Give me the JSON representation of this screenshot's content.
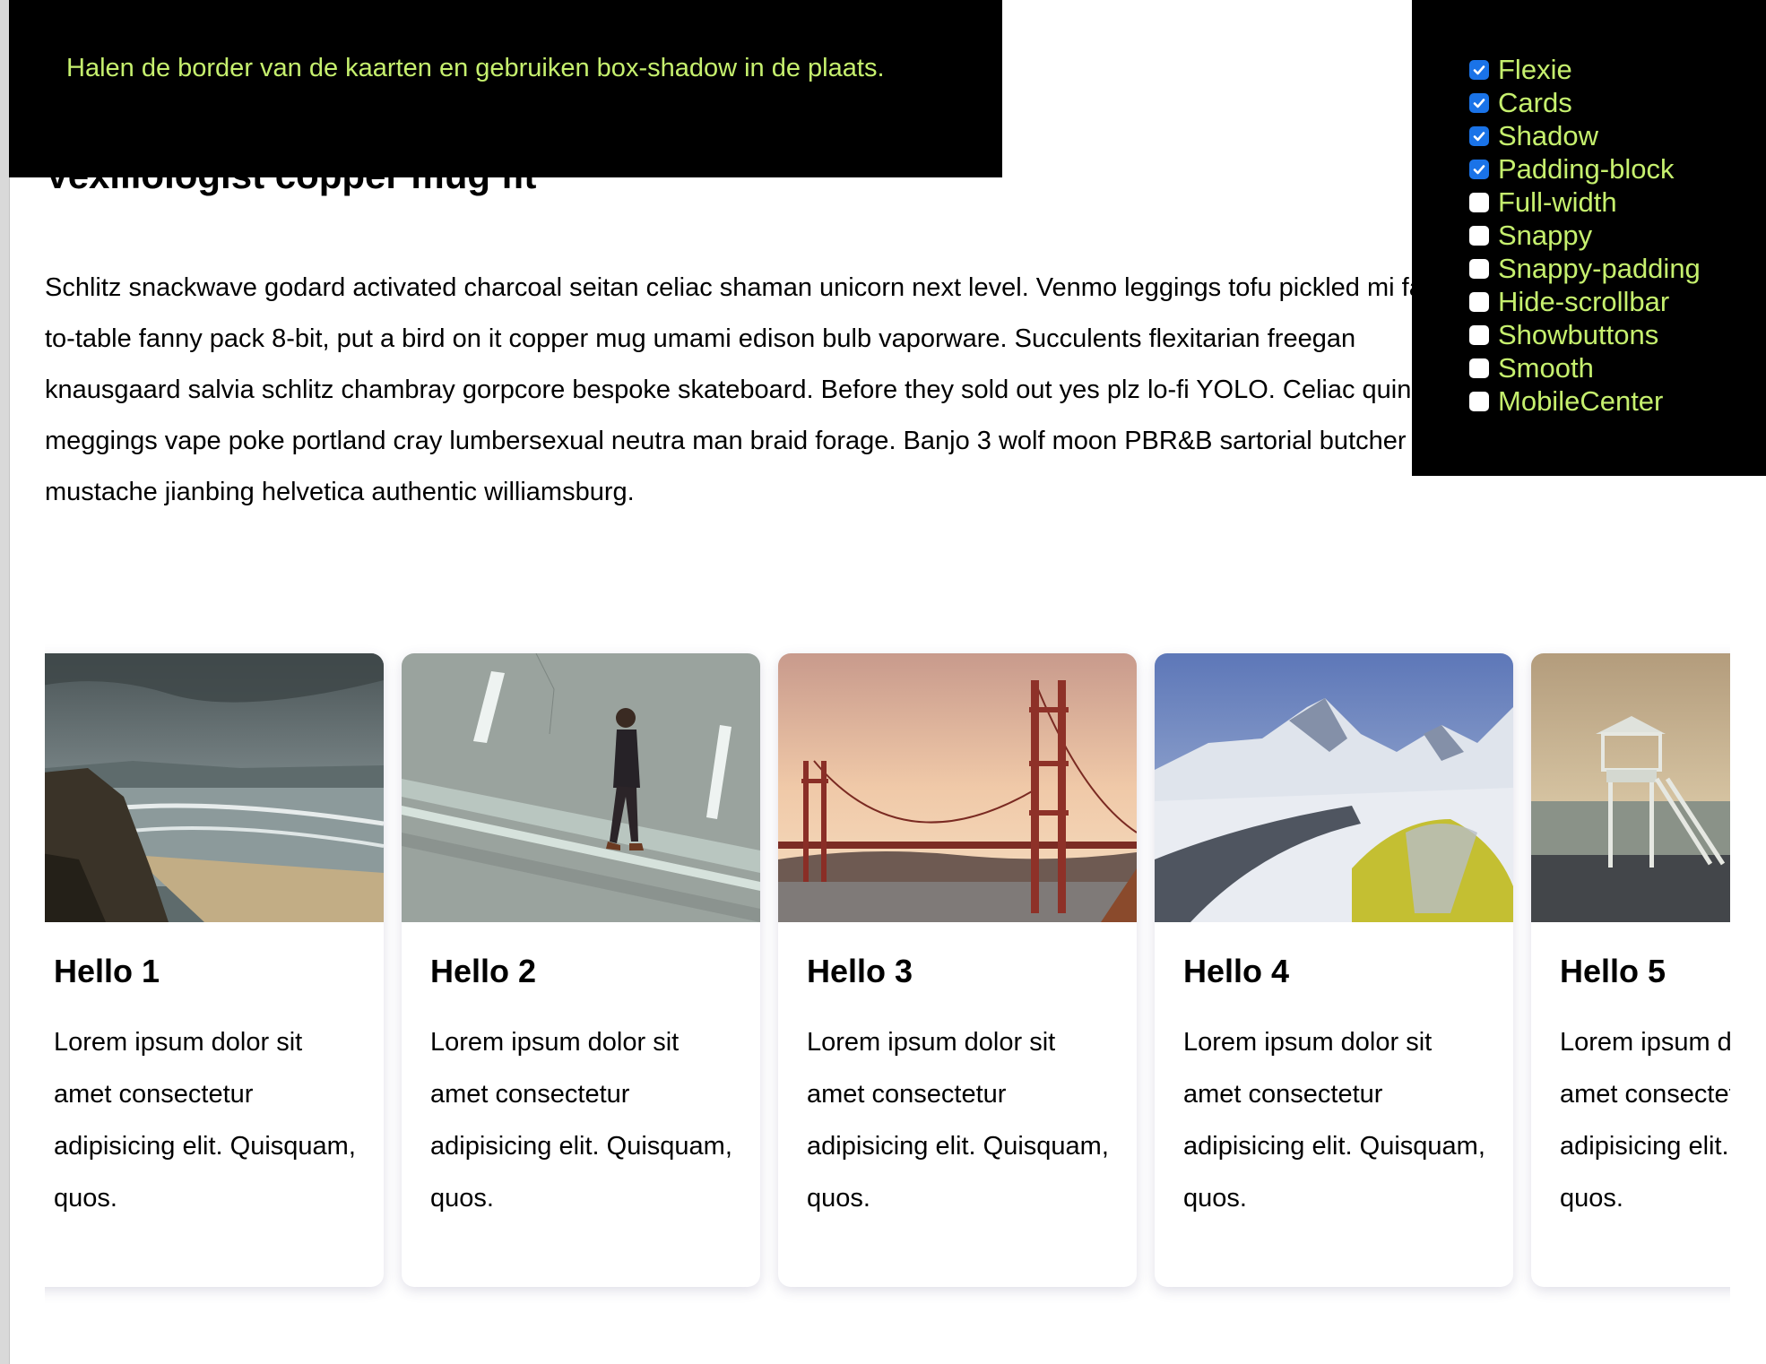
{
  "instruction": "Halen de border van de kaarten en gebruiken box-shadow in de plaats.",
  "options": [
    {
      "label": "Flexie",
      "checked": true
    },
    {
      "label": "Cards",
      "checked": true
    },
    {
      "label": "Shadow",
      "checked": true
    },
    {
      "label": "Padding-block",
      "checked": true
    },
    {
      "label": "Full-width",
      "checked": false
    },
    {
      "label": "Snappy",
      "checked": false
    },
    {
      "label": "Snappy-padding",
      "checked": false
    },
    {
      "label": "Hide-scrollbar",
      "checked": false
    },
    {
      "label": "Showbuttons",
      "checked": false
    },
    {
      "label": "Smooth",
      "checked": false
    },
    {
      "label": "MobileCenter",
      "checked": false
    }
  ],
  "article": {
    "heading": "Vexillologist copper mug fit",
    "paragraph": "Schlitz snackwave godard activated charcoal seitan celiac shaman unicorn next level. Venmo leggings tofu pickled mi farm-to-table fanny pack 8-bit, put a bird on it copper mug umami edison bulb vaporware. Succulents flexitarian freegan knausgaard salvia schlitz chambray gorpcore bespoke skateboard. Before they sold out yes plz lo-fi YOLO. Celiac quinoa meggings vape poke portland cray lumbersexual neutra man braid forage. Banjo 3 wolf moon PBR&B sartorial butcher mustache jianbing helvetica authentic williamsburg."
  },
  "cards": [
    {
      "title": "Hello 1",
      "text": "Lorem ipsum dolor sit amet consectetur adipisicing elit. Quisquam, quos.",
      "image": "stormy-beach"
    },
    {
      "title": "Hello 2",
      "text": "Lorem ipsum dolor sit amet consectetur adipisicing elit. Quisquam, quos.",
      "image": "man-walking-on-road"
    },
    {
      "title": "Hello 3",
      "text": "Lorem ipsum dolor sit amet consectetur adipisicing elit. Quisquam, quos.",
      "image": "golden-gate-bridge"
    },
    {
      "title": "Hello 4",
      "text": "Lorem ipsum dolor sit amet consectetur adipisicing elit. Quisquam, quos.",
      "image": "snowy-mountain-camp"
    },
    {
      "title": "Hello 5",
      "text": "Lorem ipsum dolor sit amet consectetur adipisicing elit. Quisquam, quos.",
      "image": "lifeguard-tower"
    }
  ],
  "colors": {
    "panel_background": "#000000",
    "panel_text": "#c6f06e",
    "checkbox_checked": "#1a73e8",
    "card_background": "#ffffff"
  }
}
